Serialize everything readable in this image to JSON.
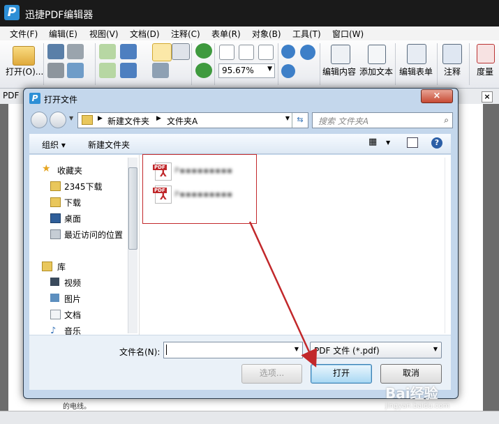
{
  "app": {
    "title": "迅捷PDF编辑器",
    "logo_letter": "P"
  },
  "menu": [
    "文件(F)",
    "编辑(E)",
    "视图(V)",
    "文档(D)",
    "注释(C)",
    "表单(R)",
    "对象(B)",
    "工具(T)",
    "窗口(W)"
  ],
  "ribbon": {
    "open_label": "打开(O)...",
    "zoom_value": "95.67%",
    "edit_content": "编辑内容",
    "add_text": "添加文本",
    "edit_form": "编辑表单",
    "annotate": "注释",
    "measure": "度量"
  },
  "doc_tab": {
    "label": "PDF",
    "close": "×"
  },
  "page_text": "的电线。",
  "dialog": {
    "title": "打开文件",
    "close": "×",
    "breadcrumb": [
      "新建文件夹",
      "文件夹A"
    ],
    "search_placeholder": "搜索 文件夹A",
    "organize": "组织 ▾",
    "new_folder": "新建文件夹",
    "help": "?",
    "nav": {
      "favorites_header": "收藏夹",
      "favorites": [
        "2345下载",
        "下载",
        "桌面",
        "最近访问的位置"
      ],
      "library_header": "库",
      "library": [
        "视频",
        "图片",
        "文档",
        "音乐"
      ]
    },
    "files": [
      {
        "badge": "PDF",
        "name": "P▪▪▪▪▪▪▪▪▪"
      },
      {
        "badge": "PDF",
        "name": "P▪▪▪▪▪▪▪▪▪"
      }
    ],
    "filename_label": "文件名(N):",
    "filename_value": "",
    "filetype_value": "PDF 文件 (*.pdf)",
    "options_button": "选项...",
    "open_button": "打开",
    "cancel_button": "取消"
  },
  "watermark": {
    "main": "Bai经验",
    "sub": "jingyan.baidu.com"
  },
  "colors": {
    "annotation": "#c2282b",
    "pdf_red": "#c0282b",
    "logo_blue": "#2d8fd6"
  }
}
